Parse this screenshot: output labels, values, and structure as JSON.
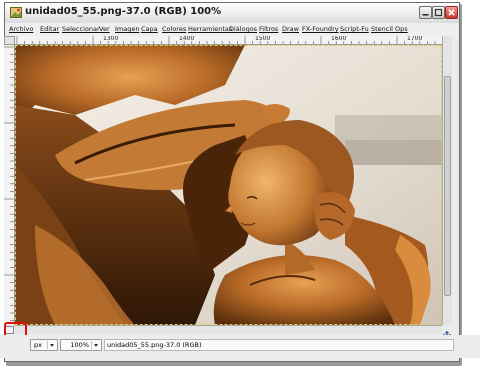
{
  "window": {
    "title": "unidad05_55.png-37.0 (RGB) 100%"
  },
  "menu": {
    "items": [
      "Archivo",
      "Editar",
      "Seleccionar",
      "Ver",
      "Imagen",
      "Capa",
      "Colores",
      "Herramientas",
      "Diálogos",
      "Filtros",
      "Draw",
      "FX-Foundry",
      "Script-Fu",
      "Stencil Ops"
    ]
  },
  "ruler": {
    "h_labels": [
      "1300",
      "1400",
      "1500",
      "1600",
      "1700"
    ]
  },
  "status": {
    "unit": "px",
    "zoom": "100%",
    "message": "unidad05_55.png-37.0 (RGB)"
  },
  "colors": {
    "highlight": "#e01010",
    "canvas_border": "#d8d060"
  },
  "icons": [
    "gimp-image-icon",
    "minimize-icon",
    "maximize-icon",
    "close-icon",
    "quick-mask-icon",
    "navigate-icon",
    "chevron-down-icon"
  ]
}
